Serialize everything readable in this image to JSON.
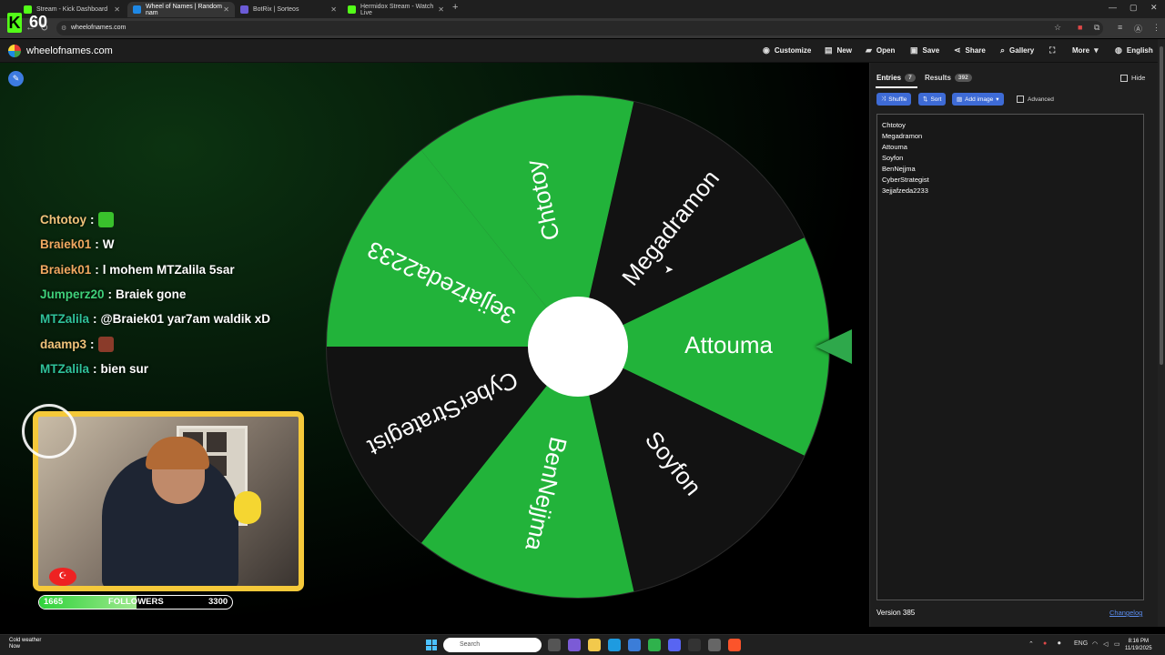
{
  "browser": {
    "tabs": [
      {
        "label": "Stream - Kick Dashboard",
        "favicon_color": "#53fc18"
      },
      {
        "label": "Wheel of Names | Random nam",
        "favicon_color": "#1e88e5"
      },
      {
        "label": "BotRix | Sorteos",
        "favicon_color": "#6b5bd6"
      },
      {
        "label": "Hermidox Stream - Watch Live",
        "favicon_color": "#53fc18"
      }
    ],
    "url": "wheelofnames.com"
  },
  "overlay": {
    "kick_logo": "K",
    "viewer_count": "60"
  },
  "app": {
    "brand": "wheelofnames.com",
    "menu": [
      "Customize",
      "New",
      "Open",
      "Save",
      "Share",
      "Gallery",
      "More",
      "English"
    ]
  },
  "chat": [
    {
      "user": "Chtotoy",
      "text": "",
      "color": "#f0c27a",
      "emote": "#39c12c"
    },
    {
      "user": "Braiek01",
      "text": "W",
      "color": "#f0a860"
    },
    {
      "user": "Braiek01",
      "text": "l mohem MTZalila 5sar",
      "color": "#f0a860"
    },
    {
      "user": "Jumperz20",
      "text": "Braiek gone",
      "color": "#3fd07a"
    },
    {
      "user": "MTZalila",
      "text": "@Braiek01 yar7am waldik xD",
      "color": "#2fc29a"
    },
    {
      "user": "daamp3",
      "text": "",
      "color": "#f0c27a",
      "emote": "#8a3b2a"
    },
    {
      "user": "MTZalila",
      "text": "bien sur",
      "color": "#2fc29a"
    }
  ],
  "followers": {
    "current": "1665",
    "label": "FOLLOWERS",
    "goal": "3300",
    "progress": 0.505
  },
  "wheel": {
    "segments": [
      "Chtotoy",
      "Megadramon",
      "Attouma",
      "Soyfon",
      "BenNejjma",
      "CyberStrategist",
      "3ejjafzeda2233"
    ],
    "colors": [
      "#22b33a",
      "#121212"
    ],
    "hub_color": "#ffffff",
    "rotation_deg": 0
  },
  "panel": {
    "tabs": [
      {
        "label": "Entries",
        "badge": "7"
      },
      {
        "label": "Results",
        "badge": "392"
      }
    ],
    "hide_label": "Hide",
    "buttons": [
      "Shuffle",
      "Sort",
      "Add image"
    ],
    "advanced_label": "Advanced",
    "entries": [
      "Chtotoy",
      "Megadramon",
      "Attouma",
      "Soyfon",
      "BenNejjma",
      "CyberStrategist",
      "3ejjafzeda2233"
    ],
    "version": "Version 385",
    "changelog": "Changelog"
  },
  "taskbar": {
    "weather_title": "Cold weather",
    "weather_sub": "Now",
    "search_placeholder": "Search",
    "language": "ENG",
    "time": "8:16 PM",
    "date": "11/19/2025"
  }
}
